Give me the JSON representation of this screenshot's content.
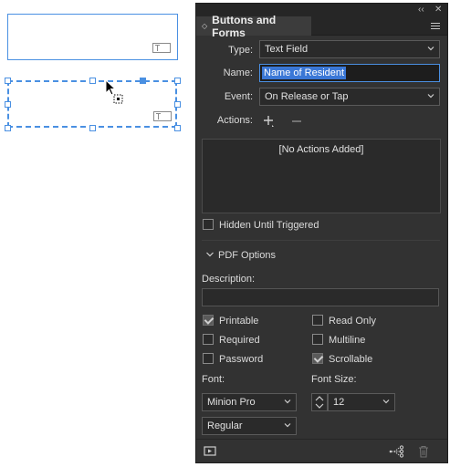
{
  "panel": {
    "title": "Buttons and Forms",
    "topbar": {
      "collapse": "‹‹",
      "close": "✕"
    },
    "type_label": "Type:",
    "type_value": "Text Field",
    "name_label": "Name:",
    "name_value": "Name of Resident",
    "event_label": "Event:",
    "event_value": "On Release or Tap",
    "actions_label": "Actions:",
    "actions_empty": "[No Actions Added]",
    "hidden_label": "Hidden Until Triggered",
    "pdf_options_label": "PDF Options",
    "description_label": "Description:",
    "description_value": "",
    "checkboxes": [
      {
        "label": "Printable",
        "checked": true
      },
      {
        "label": "Read Only",
        "checked": false
      },
      {
        "label": "Required",
        "checked": false
      },
      {
        "label": "Multiline",
        "checked": false
      },
      {
        "label": "Password",
        "checked": false
      },
      {
        "label": "Scrollable",
        "checked": true
      }
    ],
    "font_label": "Font:",
    "font_value": "Minion Pro",
    "font_style_value": "Regular",
    "font_size_label": "Font Size:",
    "font_size_value": "12"
  },
  "colors": {
    "panel_bg": "#323232",
    "selection_blue": "#4a90e2"
  },
  "icons": [
    "collapse-panel-icon",
    "close-panel-icon",
    "panel-menu-icon",
    "chevron-down-icon",
    "add-action-icon",
    "remove-action-icon",
    "preview-icon",
    "convert-to-button-icon",
    "delete-icon",
    "text-field-icon",
    "cursor-arrow-icon"
  ]
}
